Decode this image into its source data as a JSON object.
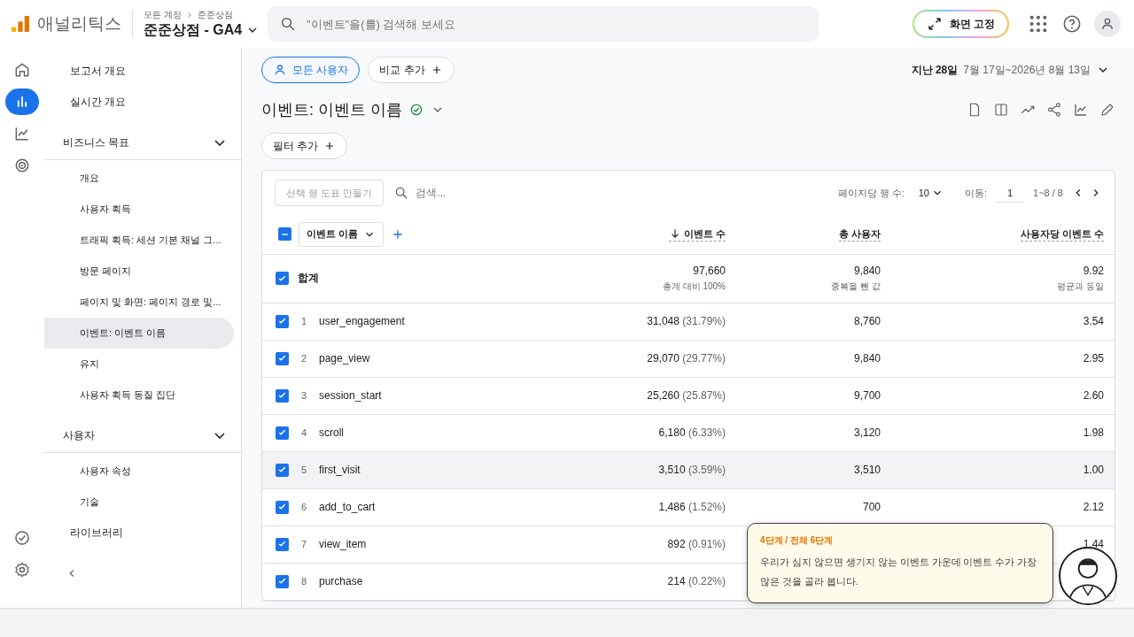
{
  "header": {
    "product": "애널리틱스",
    "breadcrumb": [
      "모든 계정",
      "준준상점"
    ],
    "property": "준준상점 - GA4",
    "search_placeholder": "\"이벤트\"을(를) 검색해 보세요",
    "pin_button": "화면 고정"
  },
  "rail": [
    {
      "kind": "home",
      "selected": false
    },
    {
      "kind": "reports",
      "selected": true
    },
    {
      "kind": "explore",
      "selected": false
    },
    {
      "kind": "ads",
      "selected": false
    }
  ],
  "nav": [
    {
      "kind": "link",
      "label": "보고서 개요",
      "selected": false
    },
    {
      "kind": "link",
      "label": "실시간 개요",
      "selected": false
    },
    {
      "kind": "section",
      "label": "비즈니스 목표",
      "expanded": true,
      "children": [
        {
          "label": "개요",
          "selected": false
        },
        {
          "label": "사용자 획득",
          "selected": false
        },
        {
          "label": "트래픽 획득: 세션 기본 채널 그...",
          "selected": false
        },
        {
          "label": "방문 페이지",
          "selected": false
        },
        {
          "label": "페이지 및 화면: 페이지 경로 및...",
          "selected": false
        },
        {
          "label": "이벤트: 이벤트 이름",
          "selected": true
        },
        {
          "label": "유지",
          "selected": false
        },
        {
          "label": "사용자 획득 동질 집단",
          "selected": false
        }
      ]
    },
    {
      "kind": "section",
      "label": "사용자",
      "expanded": true,
      "children": [
        {
          "label": "사용자 속성",
          "selected": false
        },
        {
          "label": "기술",
          "selected": false
        }
      ]
    },
    {
      "kind": "link",
      "label": "라이브러리",
      "selected": false
    }
  ],
  "toolbar": {
    "segment": "모든 사용자",
    "compare": "비교 추가",
    "date_label": "지난 28일",
    "date_range": "7월 17일~2026년 8월 13일"
  },
  "title": "이벤트: 이벤트 이름",
  "filter": "필터 추가",
  "table": {
    "plot_button": "선택 행 도표 만들기",
    "search_placeholder": "검색...",
    "rows_per_page_label": "페이지당 행 수:",
    "rows_per_page": "10",
    "goto_label": "이동:",
    "goto_value": "1",
    "range": "1~8 / 8",
    "select_all_indeterminate": true,
    "dimension": "이벤트 이름",
    "columns": [
      {
        "label": "이벤트 수",
        "sorted": true
      },
      {
        "label": "총 사용자",
        "sorted": false
      },
      {
        "label": "사용자당 이벤트 수",
        "sorted": false
      }
    ],
    "total": {
      "label": "합계",
      "checked": true,
      "values": [
        {
          "value": "97,660",
          "note": "총계 대비 100%"
        },
        {
          "value": "9,840",
          "note": "중복을 뺀 값"
        },
        {
          "value": "9.92",
          "note": "평균과 동일"
        }
      ]
    },
    "rows": [
      {
        "index": "1",
        "name": "user_engagement",
        "checked": true,
        "hovered": false,
        "count": "31,048",
        "share": "(31.79%)",
        "users": "8,760",
        "per_user": "3.54"
      },
      {
        "index": "2",
        "name": "page_view",
        "checked": true,
        "hovered": false,
        "count": "29,070",
        "share": "(29.77%)",
        "users": "9,840",
        "per_user": "2.95"
      },
      {
        "index": "3",
        "name": "session_start",
        "checked": true,
        "hovered": false,
        "count": "25,260",
        "share": "(25.87%)",
        "users": "9,700",
        "per_user": "2.60"
      },
      {
        "index": "4",
        "name": "scroll",
        "checked": true,
        "hovered": false,
        "count": "6,180",
        "share": "(6.33%)",
        "users": "3,120",
        "per_user": "1.98"
      },
      {
        "index": "5",
        "name": "first_visit",
        "checked": true,
        "hovered": true,
        "count": "3,510",
        "share": "(3.59%)",
        "users": "3,510",
        "per_user": "1.00"
      },
      {
        "index": "6",
        "name": "add_to_cart",
        "checked": true,
        "hovered": false,
        "count": "1,486",
        "share": "(1.52%)",
        "users": "700",
        "per_user": "2.12"
      },
      {
        "index": "7",
        "name": "view_item",
        "checked": true,
        "hovered": false,
        "count": "892",
        "share": "(0.91%)",
        "per_user": "1.44"
      },
      {
        "index": "8",
        "name": "purchase",
        "checked": true,
        "hovered": false,
        "count": "214",
        "share": "(0.22%)"
      }
    ]
  },
  "tutorial": {
    "step": "4단계 / 전체 6단계",
    "text": "우리가 심지 않으면 생기지 않는 이벤트 가운데 이벤트 수가 가장 많은 것을 골라 봅니다."
  }
}
